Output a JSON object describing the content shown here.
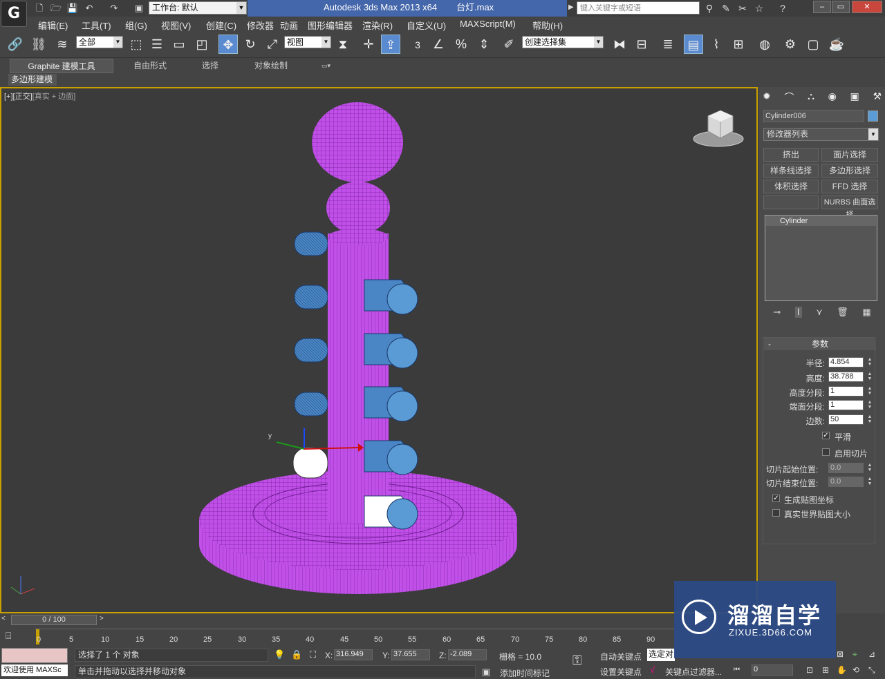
{
  "title_bar": {
    "app_title": "Autodesk 3ds Max  2013 x64",
    "file_name": "台灯.max",
    "workspace_label": "工作台: 默认",
    "search_placeholder": "键入关键字或短语"
  },
  "menu": [
    "编辑(E)",
    "工具(T)",
    "组(G)",
    "视图(V)",
    "创建(C)",
    "修改器",
    "动画",
    "图形编辑器",
    "渲染(R)",
    "自定义(U)",
    "MAXScript(M)",
    "帮助(H)"
  ],
  "toolbar": {
    "filter_select": "全部",
    "coord_select": "视图",
    "named_selection": "创建选择集",
    "snap_label": "3"
  },
  "ribbon": {
    "tabs": [
      "Graphite 建模工具",
      "自由形式",
      "选择",
      "对象绘制"
    ],
    "sub_tab": "多边形建模"
  },
  "viewport": {
    "label_plus": "[+]",
    "label_view": "[正交]",
    "label_shading": "[真实 + 边面]",
    "object_color": "#c050e8",
    "selected_color": "#4a86c6"
  },
  "command_panel": {
    "object_name": "Cylinder006",
    "object_color": "#5b9bd5",
    "modifier_list": "修改器列表",
    "modifier_buttons": [
      "挤出",
      "面片选择",
      "样条线选择",
      "多边形选择",
      "体积选择",
      "FFD 选择",
      "",
      "NURBS 曲面选择"
    ],
    "stack_item": "Cylinder",
    "rollout_title": "参数",
    "params": [
      {
        "label": "半径:",
        "value": "4.854"
      },
      {
        "label": "高度:",
        "value": "38.788"
      },
      {
        "label": "高度分段:",
        "value": "1"
      },
      {
        "label": "端面分段:",
        "value": "1"
      },
      {
        "label": "边数:",
        "value": "50"
      }
    ],
    "smooth_label": "平滑",
    "slice_label": "启用切片",
    "slice_from_label": "切片起始位置:",
    "slice_from_value": "0.0",
    "slice_to_label": "切片结束位置:",
    "slice_to_value": "0.0",
    "gen_map_label": "生成贴图坐标",
    "real_world_label": "真实世界贴图大小"
  },
  "timeline": {
    "frame_counter": "0 / 100",
    "ticks": [
      "0",
      "5",
      "10",
      "15",
      "20",
      "25",
      "30",
      "35",
      "40",
      "45",
      "50",
      "55",
      "60",
      "65",
      "70",
      "75",
      "80",
      "85",
      "90"
    ]
  },
  "status": {
    "selection_msg": "选择了 1 个 对象",
    "prompt_msg": "单击并拖动以选择并移动对象",
    "welcome": "欢迎使用 MAXSc",
    "x_label": "X:",
    "x_value": "316.949",
    "y_label": "Y:",
    "y_value": "37.655",
    "z_label": "Z:",
    "z_value": "-2.089",
    "grid": "栅格 = 10.0",
    "add_time_tag": "添加时间标记",
    "auto_key": "自动关键点",
    "set_key": "设置关键点",
    "selected_obj": "选定对",
    "key_filters": "关键点过滤器...",
    "frame_value": "0"
  },
  "watermark": {
    "brand": "溜溜自学",
    "url": "ZIXUE.3D66.COM"
  }
}
